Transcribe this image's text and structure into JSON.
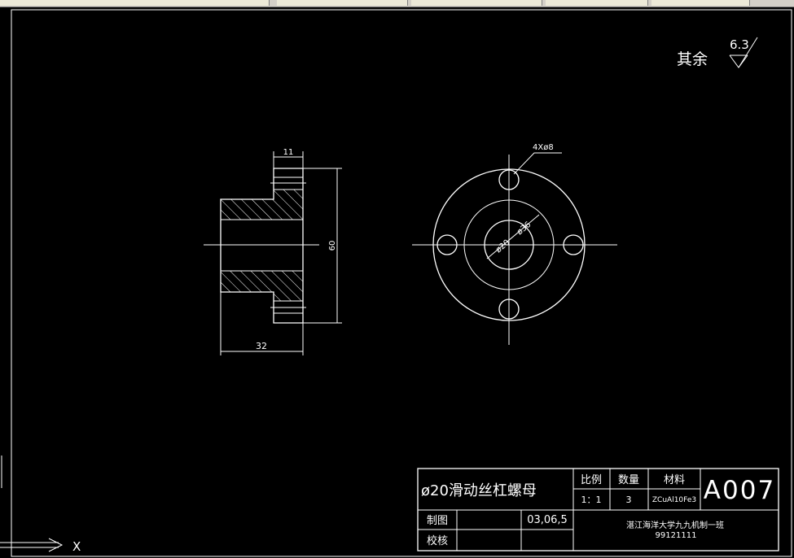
{
  "drawing": {
    "roughness_label": "其余",
    "roughness_value": "6.3",
    "dims": {
      "top_width": "11",
      "height": "60",
      "length": "32",
      "holes": "4Xø8",
      "d20": "ø20",
      "d36": "ø36"
    }
  },
  "title_block": {
    "part_name": "ø20滑动丝杠螺母",
    "scale_label": "比例",
    "scale_value": "1：1",
    "qty_label": "数量",
    "qty_value": "3",
    "material_label": "材料",
    "material_value": "ZCuAl10Fe3",
    "drawing_no": "A007",
    "drawn_label": "制图",
    "drawn_date": "03,06,5",
    "checked_label": "校核",
    "school": "湛江海洋大学九九机制一班",
    "student_id": "99121111"
  },
  "ucs": {
    "x_label": "X"
  }
}
